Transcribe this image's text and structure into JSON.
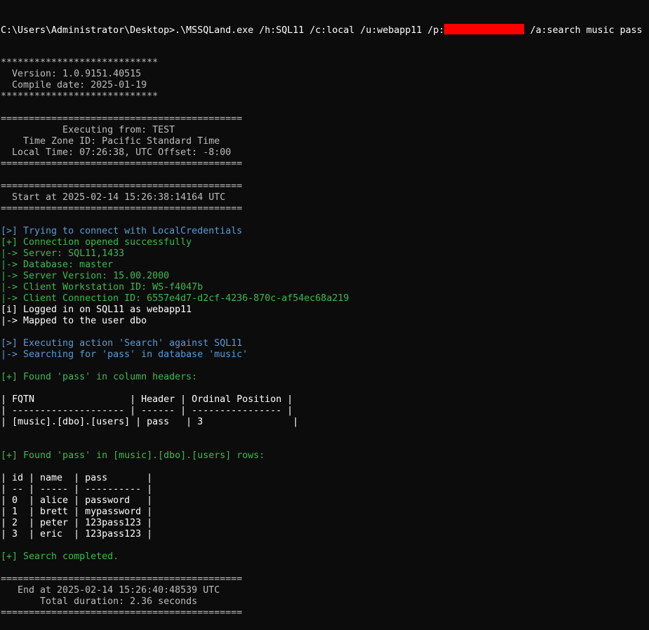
{
  "command": {
    "prompt_before": "C:\\Users\\Administrator\\Desktop>.\\MSSQLand.exe /h:SQL11 /c:local /u:webapp11 /p:",
    "prompt_after": " /a:search music pass"
  },
  "colors": {
    "background": "#0c0c0c",
    "default_text": "#cccccc",
    "info_blue": "#5b9bd5",
    "success_green": "#3fb950",
    "redaction": "#ff0000"
  },
  "lines": [
    {
      "text": "****************************",
      "color": "gray"
    },
    {
      "text": "  Version: 1.0.9151.40515",
      "color": "gray"
    },
    {
      "text": "  Compile date: 2025-01-19",
      "color": "gray"
    },
    {
      "text": "****************************",
      "color": "gray"
    },
    {
      "text": "",
      "color": "gray"
    },
    {
      "text": "===========================================",
      "color": "gray"
    },
    {
      "text": "           Executing from: TEST",
      "color": "gray"
    },
    {
      "text": "    Time Zone ID: Pacific Standard Time",
      "color": "gray"
    },
    {
      "text": "  Local Time: 07:26:38, UTC Offset: -8:00",
      "color": "gray"
    },
    {
      "text": "===========================================",
      "color": "gray"
    },
    {
      "text": "",
      "color": "gray"
    },
    {
      "text": "===========================================",
      "color": "gray"
    },
    {
      "text": "  Start at 2025-02-14 15:26:38:14164 UTC",
      "color": "gray"
    },
    {
      "text": "===========================================",
      "color": "gray"
    },
    {
      "text": "",
      "color": "gray"
    },
    {
      "text": "[>] Trying to connect with LocalCredentials",
      "color": "blue"
    },
    {
      "text": "[+] Connection opened successfully",
      "color": "green"
    },
    {
      "text": "|-> Server: SQL11,1433",
      "color": "green"
    },
    {
      "text": "|-> Database: master",
      "color": "green"
    },
    {
      "text": "|-> Server Version: 15.00.2000",
      "color": "green"
    },
    {
      "text": "|-> Client Workstation ID: WS-f4047b",
      "color": "green"
    },
    {
      "text": "|-> Client Connection ID: 6557e4d7-d2cf-4236-870c-af54ec68a219",
      "color": "green"
    },
    {
      "text": "[i] Logged in on SQL11 as webapp11",
      "color": "white"
    },
    {
      "text": "|-> Mapped to the user dbo",
      "color": "white"
    },
    {
      "text": "",
      "color": "gray"
    },
    {
      "text": "[>] Executing action 'Search' against SQL11",
      "color": "blue"
    },
    {
      "text": "|-> Searching for 'pass' in database 'music'",
      "color": "blue"
    },
    {
      "text": "",
      "color": "gray"
    },
    {
      "text": "[+] Found 'pass' in column headers:",
      "color": "green"
    },
    {
      "text": "",
      "color": "gray"
    },
    {
      "text": "| FQTN                 | Header | Ordinal Position |",
      "color": "white"
    },
    {
      "text": "| -------------------- | ------ | ---------------- |",
      "color": "white"
    },
    {
      "text": "| [music].[dbo].[users] | pass   | 3                |",
      "color": "white"
    },
    {
      "text": "",
      "color": "gray"
    },
    {
      "text": "",
      "color": "gray"
    },
    {
      "text": "[+] Found 'pass' in [music].[dbo].[users] rows:",
      "color": "green"
    },
    {
      "text": "",
      "color": "gray"
    },
    {
      "text": "| id | name  | pass       |",
      "color": "white"
    },
    {
      "text": "| -- | ----- | ---------- |",
      "color": "white"
    },
    {
      "text": "| 0  | alice | password   |",
      "color": "white"
    },
    {
      "text": "| 1  | brett | mypassword |",
      "color": "white"
    },
    {
      "text": "| 2  | peter | 123pass123 |",
      "color": "white"
    },
    {
      "text": "| 3  | eric  | 123pass123 |",
      "color": "white"
    },
    {
      "text": "",
      "color": "gray"
    },
    {
      "text": "[+] Search completed.",
      "color": "green"
    },
    {
      "text": "",
      "color": "gray"
    },
    {
      "text": "===========================================",
      "color": "gray"
    },
    {
      "text": "   End at 2025-02-14 15:26:40:48539 UTC",
      "color": "gray"
    },
    {
      "text": "       Total duration: 2.36 seconds",
      "color": "gray"
    },
    {
      "text": "===========================================",
      "color": "gray"
    }
  ]
}
